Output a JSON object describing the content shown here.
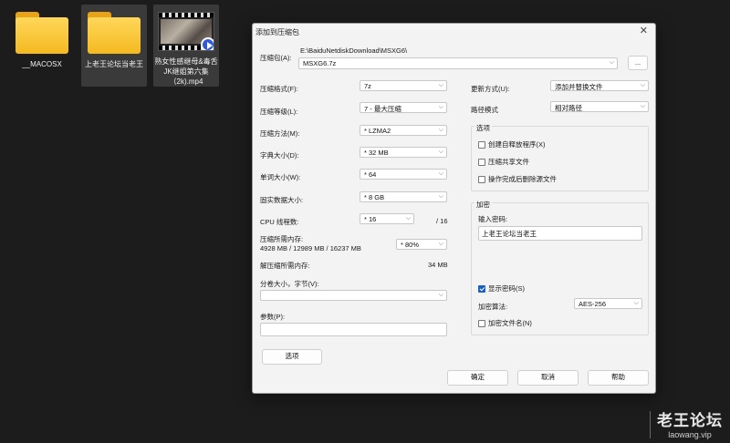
{
  "desktop": {
    "icons": [
      {
        "label": "__MACOSX",
        "kind": "folder"
      },
      {
        "label": "上老王论坛当老王",
        "kind": "folder"
      },
      {
        "label": "熟女性感继母&毒舌JK继姐第六集（2k).mp4",
        "kind": "video"
      }
    ]
  },
  "dialog": {
    "title": "添加到压缩包",
    "close_symbol": "✕",
    "archive": {
      "label": "压缩包(A):",
      "path": "E:\\BaiduNetdiskDownload\\MSXG6\\",
      "name": "MSXG6.7z",
      "browse_label": "..."
    },
    "left": {
      "format": {
        "label": "压缩格式(F):",
        "value": "7z"
      },
      "level": {
        "label": "压缩等级(L):",
        "value": "7 - 最大压缩"
      },
      "method": {
        "label": "压缩方法(M):",
        "value": "* LZMA2"
      },
      "dict": {
        "label": "字典大小(D):",
        "value": "* 32 MB"
      },
      "word": {
        "label": "单词大小(W):",
        "value": "* 64"
      },
      "solid": {
        "label": "固实数据大小:",
        "value": "* 8 GB"
      },
      "threads": {
        "label": "CPU 线程数:",
        "value": "* 16",
        "max": "/ 16"
      },
      "mem_compress": {
        "label": "压缩所需内存:",
        "value": "4928 MB / 12989 MB / 16237 MB",
        "percent": "* 80%"
      },
      "mem_decompress": {
        "label": "解压缩所需内存:",
        "value": "34 MB"
      },
      "split": {
        "label": "分卷大小，字节(V):",
        "value": ""
      },
      "params": {
        "label": "参数(P):",
        "value": ""
      },
      "options_button": "选项"
    },
    "right": {
      "update": {
        "label": "更新方式(U):",
        "value": "添加并替换文件"
      },
      "pathmode": {
        "label": "路径模式",
        "value": "相对路径"
      },
      "options_group": {
        "title": "选项",
        "sfx": "创建自释放程序(X)",
        "shared": "压缩共享文件",
        "delete": "操作完成后删除源文件"
      },
      "encryption": {
        "title": "加密",
        "password_label": "输入密码:",
        "password_value": "上老王论坛当老王",
        "show_password": "显示密码(S)",
        "method_label": "加密算法:",
        "method_value": "AES-256",
        "encrypt_names": "加密文件名(N)"
      }
    },
    "buttons": {
      "ok": "确定",
      "cancel": "取消",
      "help": "帮助"
    }
  },
  "watermark": {
    "title": "老王论坛",
    "url": "laowang.vip"
  }
}
